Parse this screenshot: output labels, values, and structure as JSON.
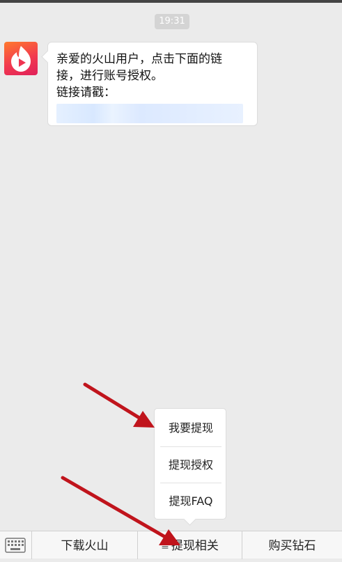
{
  "timestamp": "19:31",
  "message": {
    "sender_icon": "volcano-play-icon",
    "line1": "亲爱的火山用户，点击下面的链",
    "line2": "接，进行账号授权。",
    "line3": "链接请戳："
  },
  "popup_menu": {
    "items": [
      "我要提现",
      "提现授权",
      "提现FAQ"
    ]
  },
  "bottom_menu": {
    "keyboard_icon": "keyboard-icon",
    "items": [
      "下载火山",
      "提现相关",
      "购买钻石"
    ],
    "submenu_marker": "≡"
  },
  "colors": {
    "background": "#ebebeb",
    "annotation_arrow": "#c0141c",
    "avatar_gradient_start": "#ff7a2e",
    "avatar_gradient_end": "#e0215a"
  }
}
